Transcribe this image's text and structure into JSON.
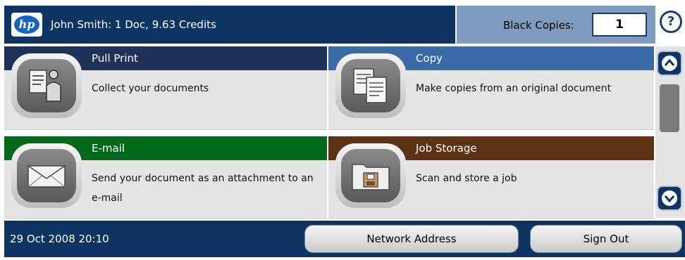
{
  "header": {
    "logo_text": "hp",
    "user_info": "John Smith: 1 Doc, 9.63 Credits",
    "copies_label": "Black Copies:",
    "copies_value": "1",
    "help_label": "?"
  },
  "tiles": [
    {
      "title": "Pull Print",
      "desc": "Collect your documents",
      "bar_color": "#1d3159",
      "icon": "pull-print-icon"
    },
    {
      "title": "Copy",
      "desc": "Make copies from an original document",
      "bar_color": "#3a6aa8",
      "icon": "copy-icon"
    },
    {
      "title": "E-mail",
      "desc": "Send your document as an attachment to an e-mail",
      "bar_color": "#006a1c",
      "icon": "email-icon"
    },
    {
      "title": "Job Storage",
      "desc": "Scan and store a job",
      "bar_color": "#5e3215",
      "icon": "job-storage-icon"
    }
  ],
  "footer": {
    "datetime": "29 Oct 2008  20:10",
    "network_address_label": "Network Address",
    "sign_out_label": "Sign Out"
  },
  "colors": {
    "header_bg": "#0e3462",
    "copies_panel_bg": "#7f9bbf",
    "tile_bg": "#e4e4e4"
  }
}
